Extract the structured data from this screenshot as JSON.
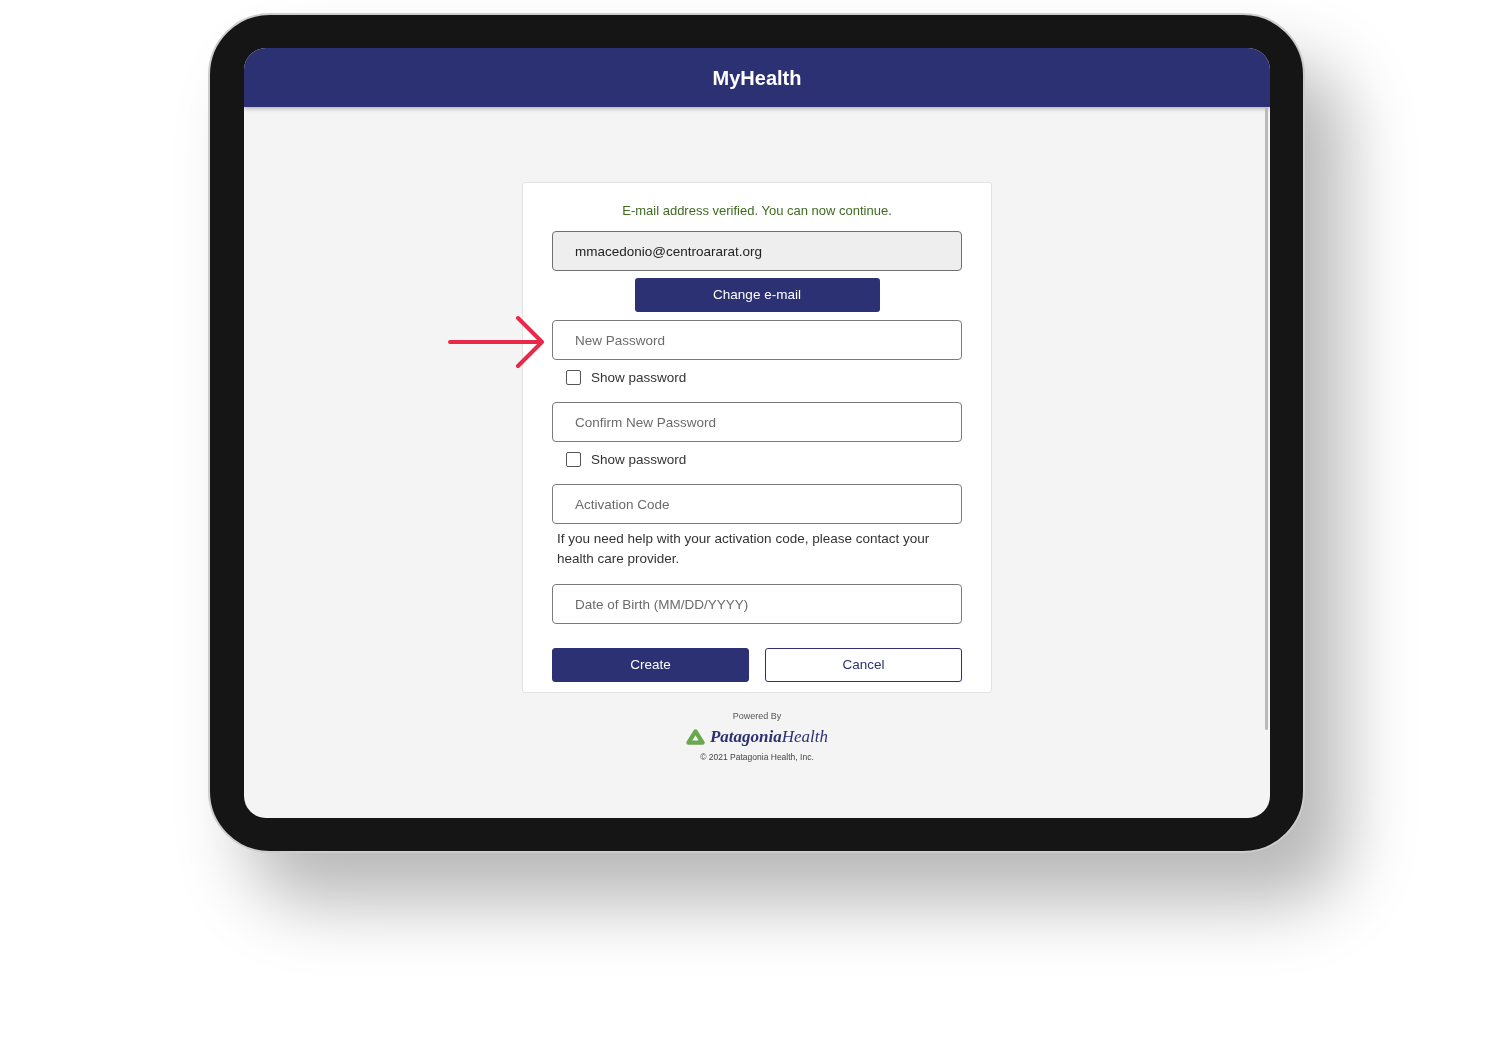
{
  "app": {
    "title": "MyHealth"
  },
  "form": {
    "items": [
      {
        "kind": "message",
        "text": "E-mail address verified. You can now continue."
      },
      {
        "kind": "input",
        "value": "mmacedonio@centroararat.org",
        "disabled": true
      },
      {
        "kind": "button",
        "label": "Change e-mail"
      },
      {
        "kind": "input",
        "placeholder": "New Password",
        "disabled": false
      },
      {
        "kind": "checkbox",
        "label": "Show password",
        "checked": false
      },
      {
        "kind": "input",
        "placeholder": "Confirm New Password",
        "disabled": false
      },
      {
        "kind": "checkbox",
        "label": "Show password",
        "checked": false
      },
      {
        "kind": "input",
        "placeholder": "Activation Code",
        "disabled": false
      },
      {
        "kind": "help",
        "text": "If you need help with your activation code, please contact your health care provider."
      },
      {
        "kind": "input",
        "placeholder": "Date of Birth (MM/DD/YYYY)",
        "disabled": false
      }
    ],
    "actions": [
      {
        "kind": "primary",
        "label": "Create"
      },
      {
        "kind": "secondary",
        "label": "Cancel"
      }
    ]
  },
  "footer": {
    "powered_by": "Powered By",
    "brand": "**Patagonia**Health",
    "copyright": "© 2021 Patagonia Health, Inc."
  }
}
